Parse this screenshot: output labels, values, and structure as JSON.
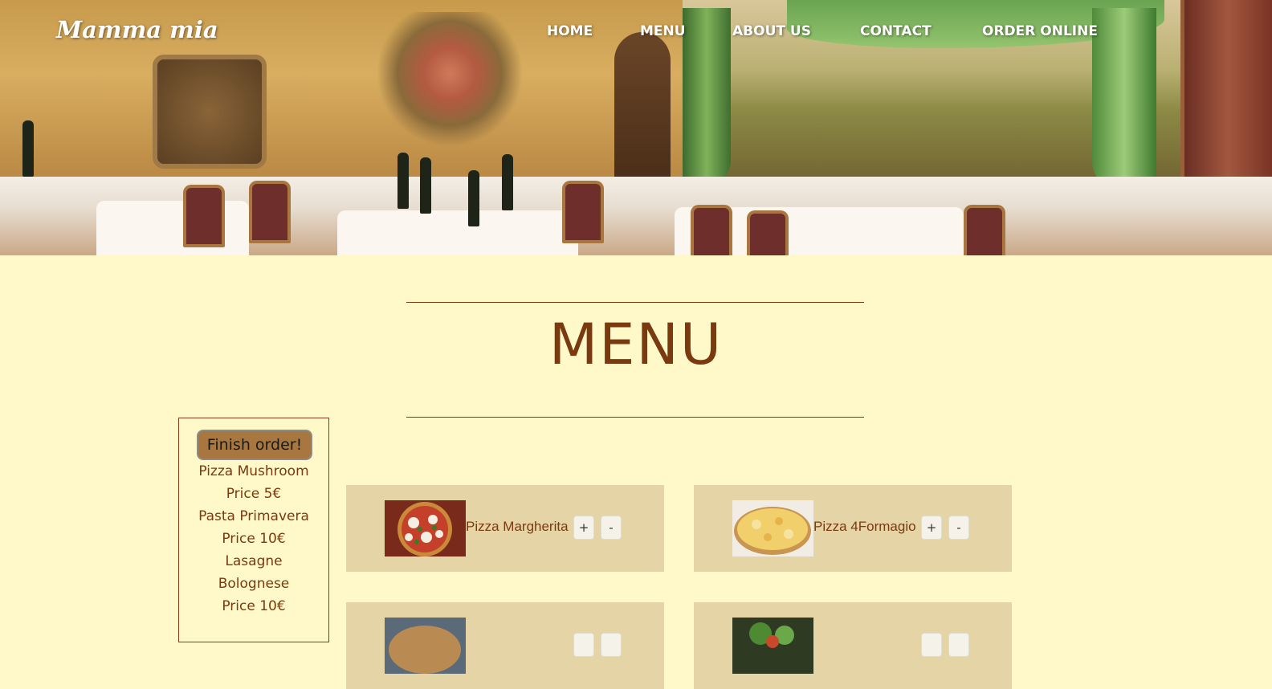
{
  "brand": {
    "logo": "Mamma mia"
  },
  "nav": {
    "items": [
      "HOME",
      "MENU",
      "ABOUT US",
      "CONTACT",
      "ORDER ONLINE"
    ]
  },
  "menu_section": {
    "title": "MENU"
  },
  "order": {
    "finish_label": "Finish order!",
    "lines": [
      "Pizza Mushroom",
      "Price 5€",
      "Pasta Primavera",
      "Price 10€",
      "Lasagne",
      "Bolognese",
      "Price 10€"
    ]
  },
  "products": [
    {
      "name": "Pizza Margherita",
      "plus": "+",
      "minus": "-",
      "image_icon": "pizza-margherita-photo"
    },
    {
      "name": "Pizza 4Formagio",
      "plus": "+",
      "minus": "-",
      "image_icon": "pizza-4formagio-photo"
    },
    {
      "name": "",
      "plus": "",
      "minus": "",
      "image_icon": "pizza-photo"
    },
    {
      "name": "",
      "plus": "",
      "minus": "",
      "image_icon": "salad-photo"
    }
  ],
  "colors": {
    "page_bg": "#fff8c9",
    "accent_brown": "#7a3a10",
    "card_bg": "#e5d5a6",
    "finish_button": "#a8773f"
  }
}
